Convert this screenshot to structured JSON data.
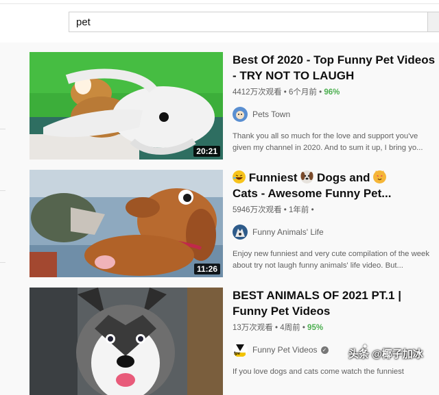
{
  "search": {
    "value": "pet"
  },
  "videos": [
    {
      "title": "Best Of 2020 - Top Funny Pet Videos - TRY NOT TO LAUGH",
      "views": "4412万次观看",
      "age": "6个月前",
      "rating": "96%",
      "duration": "20:21",
      "channel": "Pets Town",
      "description": "Thank you all so much for the love and support you've given my channel in 2020. And to sum it up, I bring yo..."
    },
    {
      "title_parts": [
        "Funniest",
        "Dogs and",
        "Cats - Awesome Funny Pet..."
      ],
      "emoji_icons": [
        "laughing-face-icon",
        "dog-face-icon",
        "cat-face-icon"
      ],
      "views": "5946万次观看",
      "age": "1年前",
      "duration": "11:26",
      "channel": "Funny Animals' Life",
      "description": "Enjoy new funniest and very cute compilation of the week about try not laugh funny animals' life video. But..."
    },
    {
      "title": "BEST ANIMALS OF 2021 PT.1 | Funny Pet Videos",
      "views": "13万次观看",
      "age": "4周前",
      "rating": "95%",
      "channel": "Funny Pet Videos",
      "avatar_text": "fpv",
      "description": "If you love dogs and cats come watch the funniest"
    }
  ],
  "watermark": {
    "text": "头条 @椰子加冰"
  },
  "colors": {
    "rating_green": "#4caf50",
    "duration_bg": "#000000"
  }
}
